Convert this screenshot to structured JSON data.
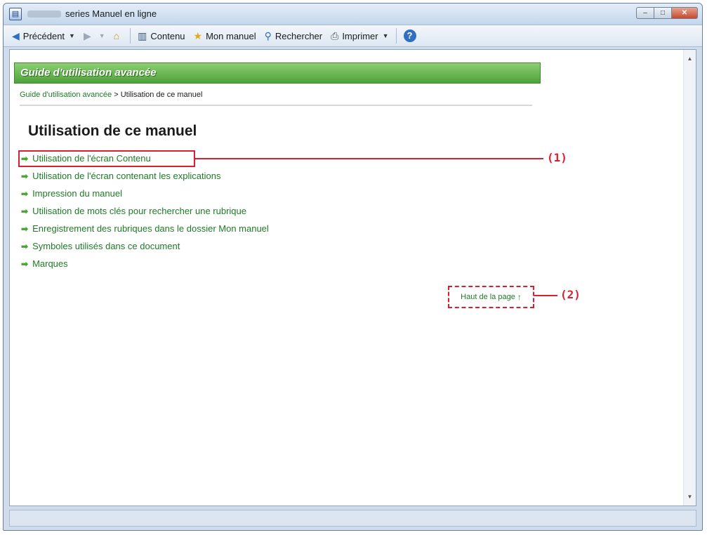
{
  "window": {
    "title": "series Manuel en ligne",
    "controls": {
      "minimize": "–",
      "maximize": "□",
      "close": "✕"
    }
  },
  "toolbar": {
    "back_label": "Précédent",
    "contents_label": "Contenu",
    "my_manual_label": "Mon manuel",
    "search_label": "Rechercher",
    "print_label": "Imprimer",
    "help_symbol": "?"
  },
  "page": {
    "header": "Guide d'utilisation avancée",
    "breadcrumb": {
      "link": "Guide d'utilisation avancée",
      "separator": " > ",
      "current": "Utilisation de ce manuel"
    },
    "title": "Utilisation de ce manuel",
    "links": [
      "Utilisation de l'écran Contenu",
      "Utilisation de l'écran contenant les explications",
      "Impression du manuel",
      "Utilisation de mots clés pour rechercher une rubrique",
      "Enregistrement des rubriques dans le dossier Mon manuel",
      "Symboles utilisés dans ce document",
      "Marques"
    ],
    "top_of_page": "Haut de la page",
    "top_arrow": "↑"
  },
  "annotations": {
    "one": "(1)",
    "two": "(2)"
  },
  "icons": {
    "back": "back-arrow-icon",
    "forward": "forward-arrow-icon",
    "home": "home-icon",
    "contents": "book-icon",
    "my_manual": "star-icon",
    "search": "magnifier-icon",
    "print": "printer-icon",
    "help": "help-icon",
    "link_arrow": "right-arrow-icon"
  },
  "colors": {
    "link_green": "#1e7a27",
    "header_green": "#4ea23a",
    "annotation_red": "#d92030"
  }
}
